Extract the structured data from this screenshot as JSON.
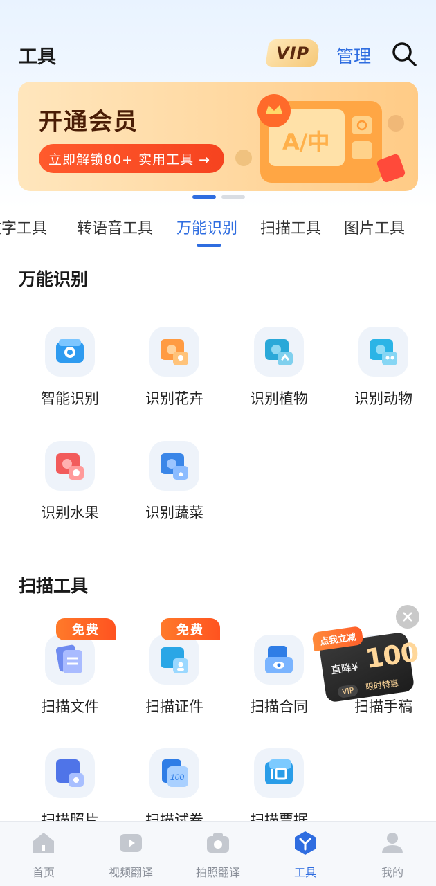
{
  "header": {
    "title": "工具",
    "vip_label": "VIP",
    "manage_label": "管理",
    "search_icon": "search-icon"
  },
  "banner": {
    "title": "开通会员",
    "cta": "立即解锁80+ 实用工具 →",
    "art_text": "A/中",
    "slides_total": 2,
    "slide_active": 1
  },
  "tabs": [
    {
      "label": "文字工具",
      "active": false
    },
    {
      "label": "转语音工具",
      "active": false
    },
    {
      "label": "万能识别",
      "active": true
    },
    {
      "label": "扫描工具",
      "active": false
    },
    {
      "label": "图片工具",
      "active": false
    }
  ],
  "sections": [
    {
      "title": "万能识别",
      "items": [
        {
          "label": "智能识别",
          "icon": "smart-recognize-icon"
        },
        {
          "label": "识别花卉",
          "icon": "flower-recognize-icon"
        },
        {
          "label": "识别植物",
          "icon": "plant-recognize-icon"
        },
        {
          "label": "识别动物",
          "icon": "animal-recognize-icon"
        },
        {
          "label": "识别水果",
          "icon": "fruit-recognize-icon"
        },
        {
          "label": "识别蔬菜",
          "icon": "vegetable-recognize-icon"
        }
      ]
    },
    {
      "title": "扫描工具",
      "items": [
        {
          "label": "扫描文件",
          "icon": "scan-file-icon",
          "tag": "免费"
        },
        {
          "label": "扫描证件",
          "icon": "scan-id-icon",
          "tag": "免费"
        },
        {
          "label": "扫描合同",
          "icon": "scan-contract-icon"
        },
        {
          "label": "扫描手稿",
          "icon": "scan-manuscript-icon"
        },
        {
          "label": "扫描照片",
          "icon": "scan-photo-icon"
        },
        {
          "label": "扫描试卷",
          "icon": "scan-exam-icon"
        },
        {
          "label": "扫描票据",
          "icon": "scan-receipt-icon"
        }
      ]
    }
  ],
  "promo": {
    "tag": "点我立减",
    "drop_label": "直降¥",
    "amount": "100",
    "vip": "VIP",
    "limited": "限时特惠"
  },
  "bottom_nav": [
    {
      "label": "首页",
      "icon": "home-icon",
      "active": false
    },
    {
      "label": "视频翻译",
      "icon": "video-translate-icon",
      "active": false
    },
    {
      "label": "拍照翻译",
      "icon": "camera-translate-icon",
      "active": false
    },
    {
      "label": "工具",
      "icon": "tools-icon",
      "active": true
    },
    {
      "label": "我的",
      "icon": "profile-icon",
      "active": false
    }
  ],
  "colors": {
    "accent": "#2f6de0",
    "promo_orange": "#ff5a2c",
    "banner_bg": "#ffd8a0"
  }
}
